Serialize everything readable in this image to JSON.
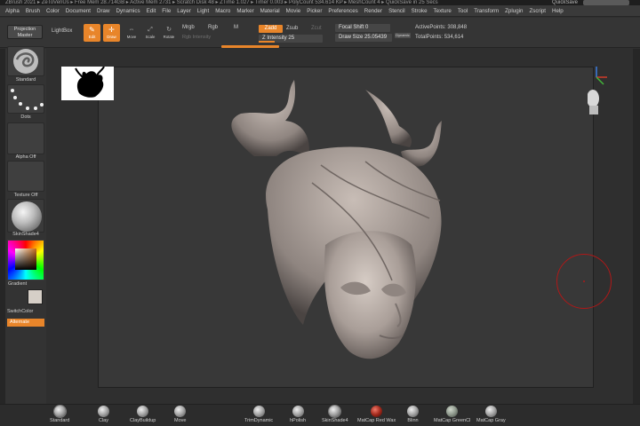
{
  "title_bar": {
    "text": "ZBrush 2021 ▸ ZeToVenUs ▸ Free Mem 28.714GB ▸ Active Mem 2731 ▸ Scratch Disk 48 ▸ ZTime 1.027 ▸ Timer 0.003 ▸ PolyCount 534.614 KP ▸ MeshCount 4 ▸ QuickSave in 25 Secs",
    "quicksave": "QuickSave"
  },
  "menu": [
    "Alpha",
    "Brush",
    "Color",
    "Document",
    "Draw",
    "Dynamics",
    "Edit",
    "File",
    "Layer",
    "Light",
    "Macro",
    "Marker",
    "Material",
    "Movie",
    "Picker",
    "Preferences",
    "Render",
    "Stencil",
    "Stroke",
    "Texture",
    "Tool",
    "Transform",
    "Zplugin",
    "Zscript",
    "Help"
  ],
  "toolbar": {
    "projection_master": "Projection Master",
    "lightbox": "LightBox",
    "edit": "Edit",
    "draw": "Draw",
    "move": "Move",
    "scale": "Scale",
    "rotate": "Rotate",
    "mrgb": "Mrgb",
    "rgb": "Rgb",
    "m": "M",
    "rgb_intensity": "Rgb Intensity",
    "zadd": "Zadd",
    "zsub": "Zsub",
    "zcut": "Zcut",
    "z_intensity_label": "Z Intensity",
    "z_intensity_value": "25",
    "z_intensity_fraction": 0.25,
    "focal_shift_label": "Focal Shift",
    "focal_shift_value": "0",
    "draw_size_label": "Draw Size",
    "draw_size_value": "25.05439",
    "dynamic": "Dynamic",
    "active_points_label": "ActivePoints:",
    "active_points_value": "308,848",
    "total_points_label": "TotalPoints:",
    "total_points_value": "534,614"
  },
  "left_panel": {
    "brush": "Standard",
    "stroke": "Dots",
    "alpha": "Alpha Off",
    "texture": "Texture Off",
    "material": "SkinShade4",
    "gradient": "Gradient",
    "switch_color": "SwitchColor",
    "alternate": "Alternate"
  },
  "bottom_brushes": [
    {
      "label": "Standard"
    },
    {
      "label": "Clay"
    },
    {
      "label": "ClayBuildup"
    },
    {
      "label": "Move"
    },
    {
      "label": "TrimDynamic"
    },
    {
      "label": "hPolish"
    },
    {
      "label": "SkinShade4"
    },
    {
      "label": "MatCap Red Wax"
    },
    {
      "label": "Blinn"
    },
    {
      "label": "MatCap GreenCl"
    },
    {
      "label": "MatCap Gray"
    }
  ],
  "colors": {
    "accent": "#e8852a",
    "cursor": "#b01818",
    "model": "#b9aea8"
  }
}
